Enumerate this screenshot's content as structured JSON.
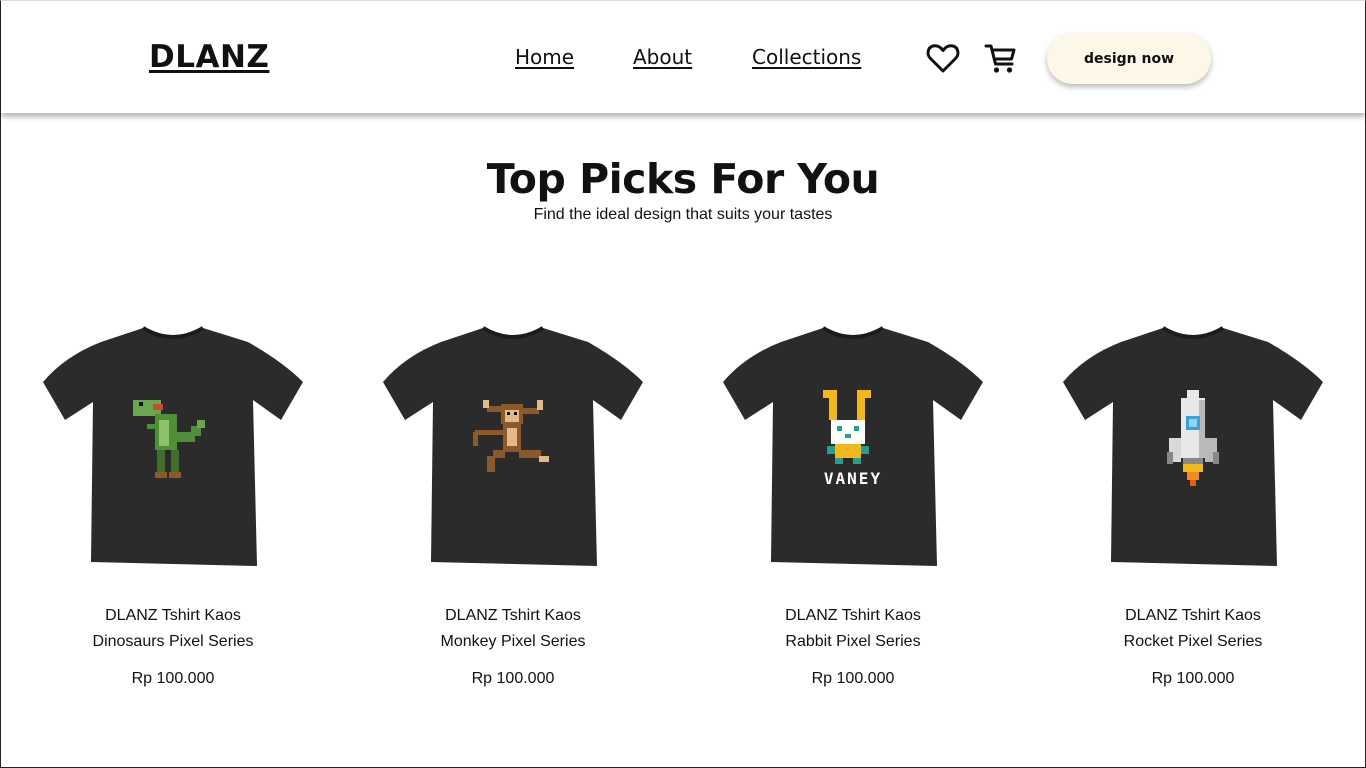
{
  "header": {
    "logo": "DLANZ",
    "nav": [
      "Home",
      "About",
      "Collections"
    ],
    "icons": [
      "heart-icon",
      "cart-icon"
    ],
    "cta_label": "design now"
  },
  "hero": {
    "title": "Top Picks For You",
    "subtitle": "Find the ideal design that suits your tastes"
  },
  "products": [
    {
      "line1": "DLANZ Tshirt Kaos",
      "line2": "Dinosaurs Pixel Series",
      "price": "Rp 100.000"
    },
    {
      "line1": "DLANZ Tshirt Kaos",
      "line2": "Monkey Pixel Series",
      "price": "Rp 100.000"
    },
    {
      "line1": "DLANZ Tshirt Kaos",
      "line2": "Rabbit Pixel Series",
      "price": "Rp 100.000"
    },
    {
      "line1": "DLANZ Tshirt Kaos",
      "line2": "Rocket Pixel Series",
      "price": "Rp 100.000"
    }
  ],
  "graphic_text": {
    "rabbit": "VANEY"
  },
  "colors": {
    "cta_background": "#fcf7e6",
    "shirt": "#2b2b2b",
    "text": "#111111"
  }
}
